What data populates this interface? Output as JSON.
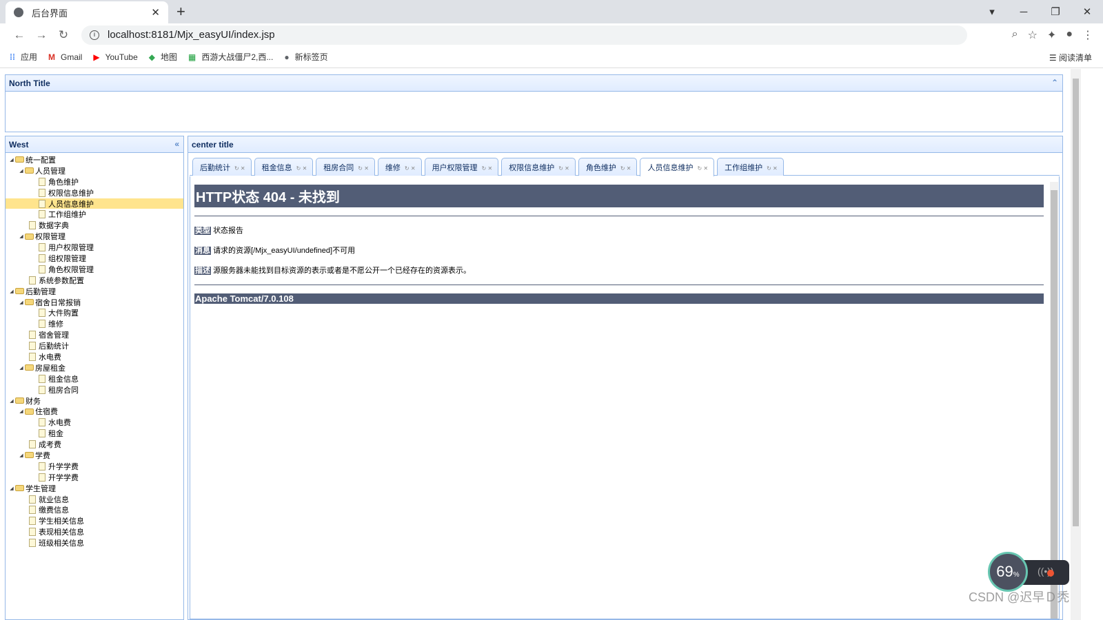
{
  "browser": {
    "tab_title": "后台界面",
    "url": "localhost:8181/Mjx_easyUI/index.jsp",
    "bookmarks": [
      "应用",
      "Gmail",
      "YouTube",
      "地图",
      "西游大战僵尸2,西...",
      "新标签页"
    ],
    "reading_list": "阅读清单"
  },
  "north": {
    "title": "North Title"
  },
  "west": {
    "title": "West"
  },
  "center": {
    "title": "center title"
  },
  "tree": [
    {
      "label": "统一配置",
      "level": 0,
      "folder": true
    },
    {
      "label": "人员管理",
      "level": 1,
      "folder": true
    },
    {
      "label": "角色维护",
      "level": 2
    },
    {
      "label": "权限信息维护",
      "level": 2
    },
    {
      "label": "人员信息维护",
      "level": 2,
      "selected": true
    },
    {
      "label": "工作组维护",
      "level": 2
    },
    {
      "label": "数据字典",
      "level": 1
    },
    {
      "label": "权限管理",
      "level": 1,
      "folder": true
    },
    {
      "label": "用户权限管理",
      "level": 2
    },
    {
      "label": "组权限管理",
      "level": 2
    },
    {
      "label": "角色权限管理",
      "level": 2
    },
    {
      "label": "系统参数配置",
      "level": 1
    },
    {
      "label": "后勤管理",
      "level": 0,
      "folder": true
    },
    {
      "label": "宿舍日常报销",
      "level": 1,
      "folder": true
    },
    {
      "label": "大件购置",
      "level": 2
    },
    {
      "label": "维修",
      "level": 2
    },
    {
      "label": "宿舍管理",
      "level": 1
    },
    {
      "label": "后勤统计",
      "level": 1
    },
    {
      "label": "水电费",
      "level": 1
    },
    {
      "label": "房屋租金",
      "level": 1,
      "folder": true
    },
    {
      "label": "租金信息",
      "level": 2
    },
    {
      "label": "租房合同",
      "level": 2
    },
    {
      "label": "财务",
      "level": 0,
      "folder": true
    },
    {
      "label": "住宿费",
      "level": 1,
      "folder": true
    },
    {
      "label": "水电费",
      "level": 2
    },
    {
      "label": "租金",
      "level": 2
    },
    {
      "label": "成考费",
      "level": 1
    },
    {
      "label": "学费",
      "level": 1,
      "folder": true
    },
    {
      "label": "升学学费",
      "level": 2
    },
    {
      "label": "开学学费",
      "level": 2
    },
    {
      "label": "学生管理",
      "level": 0,
      "folder": true
    },
    {
      "label": "就业信息",
      "level": 1
    },
    {
      "label": "缴费信息",
      "level": 1
    },
    {
      "label": "学生相关信息",
      "level": 1
    },
    {
      "label": "表现相关信息",
      "level": 1
    },
    {
      "label": "班级相关信息",
      "level": 1
    }
  ],
  "tabs": [
    {
      "label": "后勤统计"
    },
    {
      "label": "租金信息"
    },
    {
      "label": "租房合同"
    },
    {
      "label": "维修"
    },
    {
      "label": "用户权限管理"
    },
    {
      "label": "权限信息维护"
    },
    {
      "label": "角色维护"
    },
    {
      "label": "人员信息维护",
      "active": true
    },
    {
      "label": "工作组维护"
    }
  ],
  "error": {
    "heading": "HTTP状态 404 - 未找到",
    "type_label": "类型",
    "type_value": "状态报告",
    "msg_label": "消息",
    "msg_value": "请求的资源[/Mjx_easyUI/undefined]不可用",
    "desc_label": "描述",
    "desc_value": "源服务器未能找到目标资源的表示或者是不愿公开一个已经存在的资源表示。",
    "server": "Apache Tomcat/7.0.108"
  },
  "overlay": {
    "speed_percent": "69",
    "percent_sign": "%",
    "watermark": "CSDN @迟早Ｄ秃"
  }
}
